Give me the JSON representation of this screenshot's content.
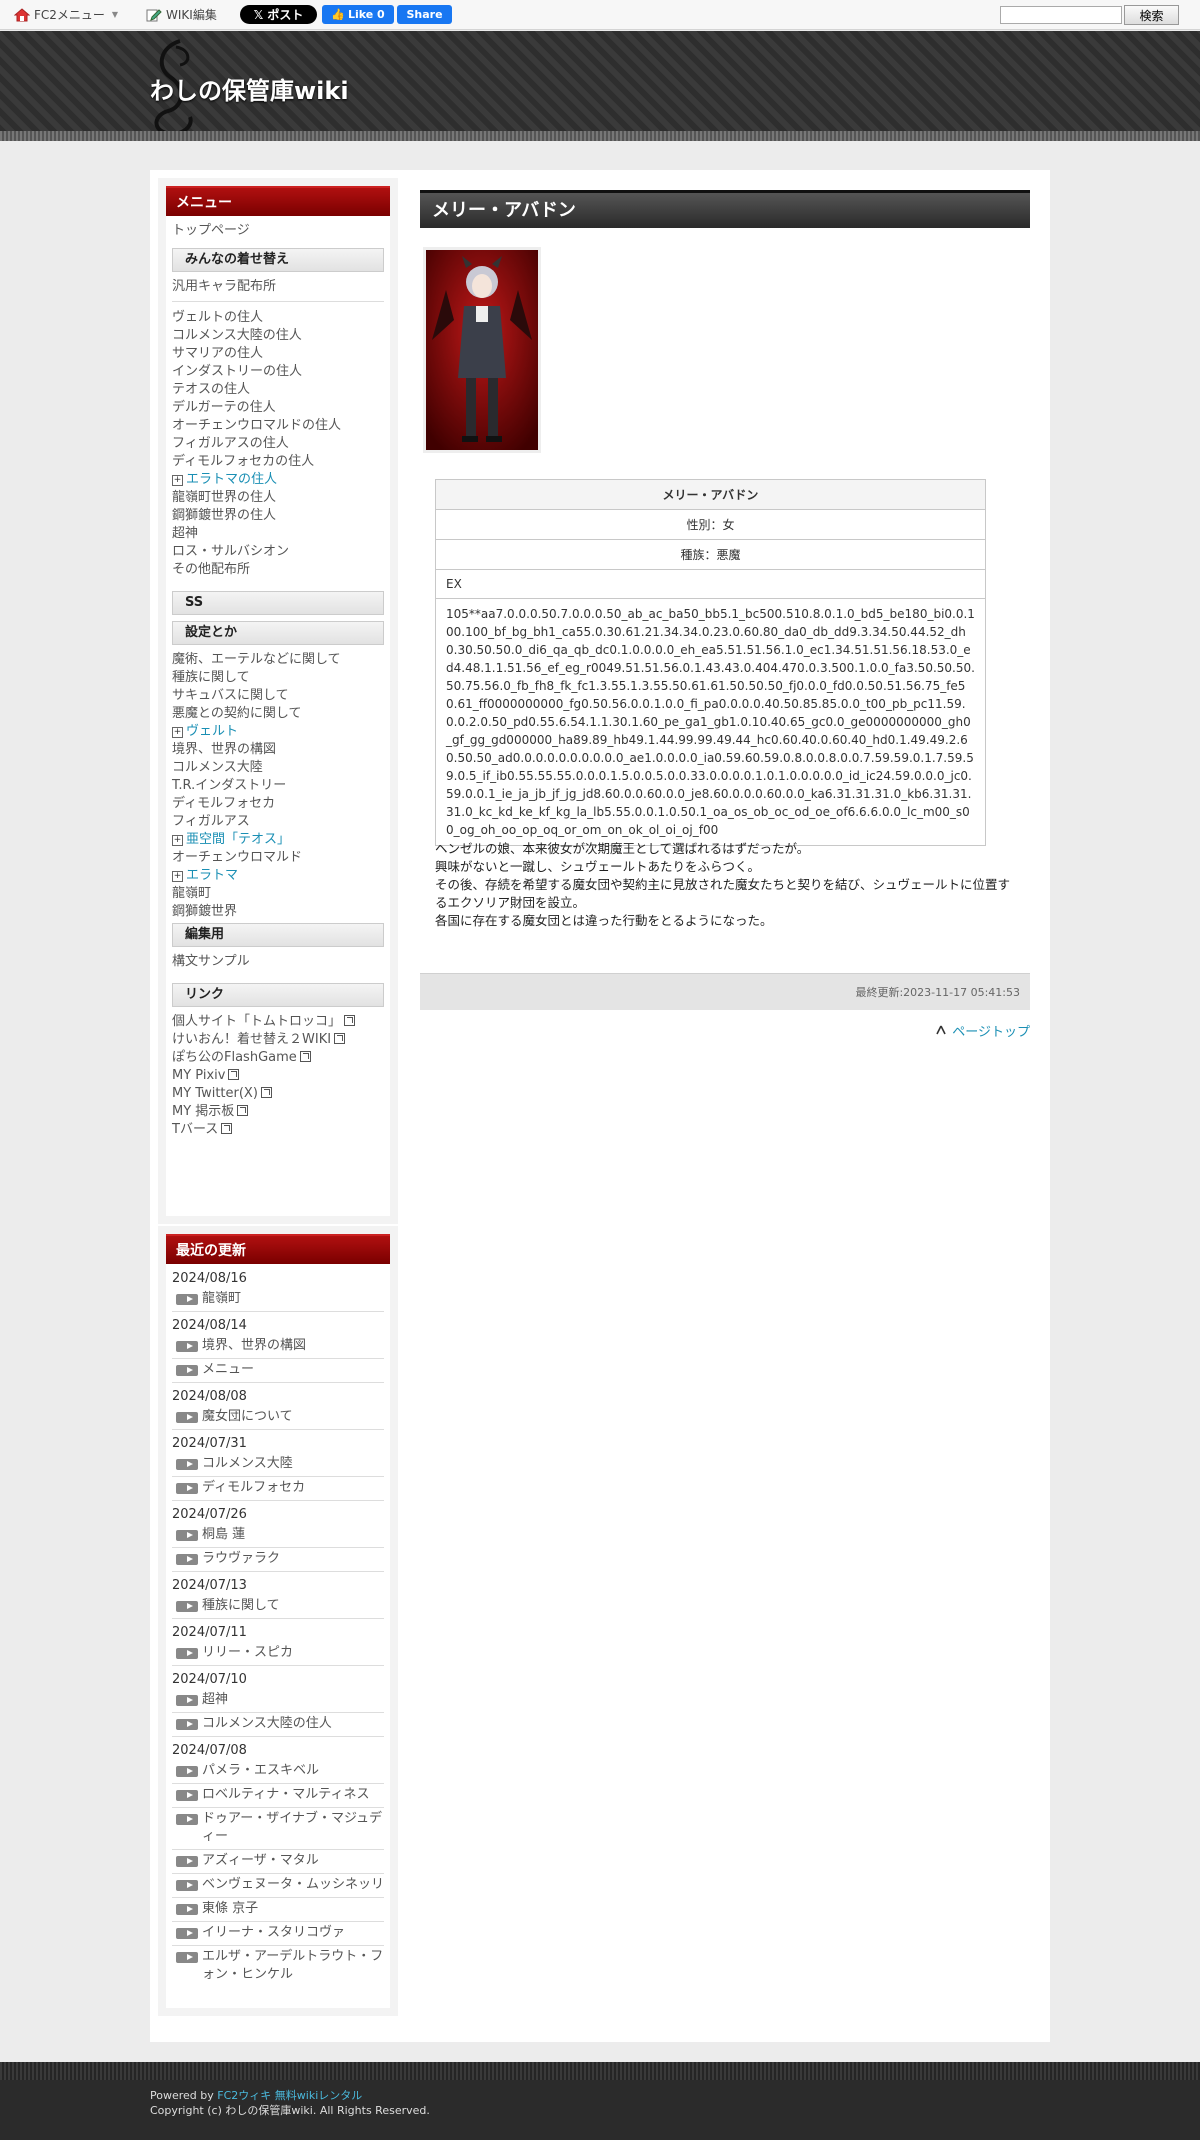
{
  "topbar": {
    "fc2_menu": "FC2メニュー",
    "wiki_edit": "WIKI編集",
    "tweet": "ポスト",
    "fb_like": "Like 0",
    "fb_share": "Share",
    "search_value": "",
    "search_button": "検索"
  },
  "header": {
    "title": "わしの保管庫wiki"
  },
  "sidebar": {
    "menu_title": "メニュー",
    "top_page": "トップページ",
    "sec1": "みんなの着せ替え",
    "generic": "汎用キャラ配布所",
    "residents": [
      "ヴェルトの住人",
      "コルメンス大陸の住人",
      "サマリアの住人",
      "インダストリーの住人",
      "テオスの住人",
      "デルガーテの住人",
      "オーチェンウロマルドの住人",
      "フィガルアスの住人",
      "ディモルフォセカの住人"
    ],
    "eratoma_residents": "エラトマの住人",
    "residents2": [
      "龍嶺町世界の住人",
      "鋼獅鍍世界の住人",
      "超神",
      "ロス・サルバシオン",
      "その他配布所"
    ],
    "sec2": "SS",
    "sec3": "設定とか",
    "settings": [
      "魔術、エーテルなどに関して",
      "種族に関して",
      "サキュバスに関して",
      "悪魔との契約に関して"
    ],
    "velt": "ヴェルト",
    "settings2": [
      "境界、世界の構図",
      "コルメンス大陸",
      "T.R.インダストリー",
      "ディモルフォセカ",
      "フィガルアス"
    ],
    "asubspace": "亜空間「テオス」",
    "settings3": [
      "オーチェンウロマルド"
    ],
    "eratoma": "エラトマ",
    "settings4": [
      "龍嶺町",
      "鋼獅鍍世界"
    ],
    "sec4": "編集用",
    "sample": "構文サンプル",
    "sec5": "リンク",
    "links": [
      "個人サイト「トムトロッコ」",
      "けいおん！着せ替え２WIKI",
      "ぽち公のFlashGame",
      "MY Pixiv",
      "MY Twitter(X)",
      "MY 掲示板",
      "Tバース"
    ],
    "recent_title": "最近の更新",
    "recent": [
      {
        "date": "2024/08/16",
        "items": [
          "龍嶺町"
        ]
      },
      {
        "date": "2024/08/14",
        "items": [
          "境界、世界の構図",
          "メニュー"
        ]
      },
      {
        "date": "2024/08/08",
        "items": [
          "魔女団について"
        ]
      },
      {
        "date": "2024/07/31",
        "items": [
          "コルメンス大陸",
          "ディモルフォセカ"
        ]
      },
      {
        "date": "2024/07/26",
        "items": [
          "桐島 蓮",
          "ラウヴァラク"
        ]
      },
      {
        "date": "2024/07/13",
        "items": [
          "種族に関して"
        ]
      },
      {
        "date": "2024/07/11",
        "items": [
          "リリー・スピカ"
        ]
      },
      {
        "date": "2024/07/10",
        "items": [
          "超神",
          "コルメンス大陸の住人"
        ]
      },
      {
        "date": "2024/07/08",
        "items": [
          "パメラ・エスキベル",
          "ロベルティナ・マルティネス",
          "ドゥアー・ザイナブ・マジュディー",
          "アズィーザ・マタル",
          "ベンヴェヌータ・ムッシネッリ",
          "東條 京子",
          "イリーナ・スタリコヴァ",
          "エルザ・アーデルトラウト・フォン・ヒンケル"
        ]
      }
    ]
  },
  "main": {
    "title": "メリー・アバドン",
    "table": {
      "name": "メリー・アバドン",
      "gender": "性別：女",
      "race": "種族：悪魔",
      "ex_label": "EX",
      "code": "105**aa7.0.0.0.50.7.0.0.0.50_ab_ac_ba50_bb5.1_bc500.510.8.0.1.0_bd5_be180_bi0.0.100.100_bf_bg_bh1_ca55.0.30.61.21.34.34.0.23.0.60.80_da0_db_dd9.3.34.50.44.52_dh0.30.50.50.0_di6_qa_qb_dc0.1.0.0.0.0_eh_ea5.51.51.56.1.0_ec1.34.51.51.56.18.53.0_ed4.48.1.1.51.56_ef_eg_r0049.51.51.56.0.1.43.43.0.404.470.0.3.500.1.0.0_fa3.50.50.50.50.75.56.0_fb_fh8_fk_fc1.3.55.1.3.55.50.61.61.50.50.50_fj0.0.0_fd0.0.50.51.56.75_fe50.61_ff0000000000_fg0.50.56.0.0.1.0.0_fi_pa0.0.0.0.40.50.85.85.0.0_t00_pb_pc11.59.0.0.2.0.50_pd0.55.6.54.1.1.30.1.60_pe_ga1_gb1.0.10.40.65_gc0.0_ge0000000000_gh0_gf_gg_gd000000_ha89.89_hb49.1.44.99.99.49.44_hc0.60.40.0.60.40_hd0.1.49.49.2.60.50.50_ad0.0.0.0.0.0.0.0.0.0_ae1.0.0.0.0_ia0.59.60.59.0.8.0.0.8.0.0.7.59.59.0.1.7.59.59.0.5_if_ib0.55.55.55.0.0.0.1.5.0.0.5.0.0.33.0.0.0.0.1.0.1.0.0.0.0.0_id_ic24.59.0.0.0_jc0.59.0.0.1_ie_ja_jb_jf_jg_jd8.60.0.0.60.0.0_je8.60.0.0.0.60.0.0_ka6.31.31.31.0_kb6.31.31.31.0_kc_kd_ke_kf_kg_la_lb5.55.0.0.1.0.50.1_oa_os_ob_oc_od_oe_of6.6.6.0.0_lc_m00_s00_og_oh_oo_op_oq_or_om_on_ok_ol_oi_oj_f00"
    },
    "desc": [
      "ヘンゼルの娘、本来彼女が次期魔王として選ばれるはずだったが。",
      "興味がないと一蹴し、シュヴェールトあたりをふらつく。",
      "その後、存続を希望する魔女団や契約主に見放された魔女たちと契りを結び、シュヴェールトに位置するエクソリア財団を設立。",
      "各国に存在する魔女団とは違った行動をとるようになった。"
    ],
    "updated": "最終更新:2023-11-17 05:41:53",
    "pagetop": "ページトップ"
  },
  "footer": {
    "powered_prefix": "Powered by ",
    "powered_link": "FC2ウィキ 無料wikiレンタル",
    "copyright": "Copyright (c) わしの保管庫wiki. All Rights Reserved."
  }
}
